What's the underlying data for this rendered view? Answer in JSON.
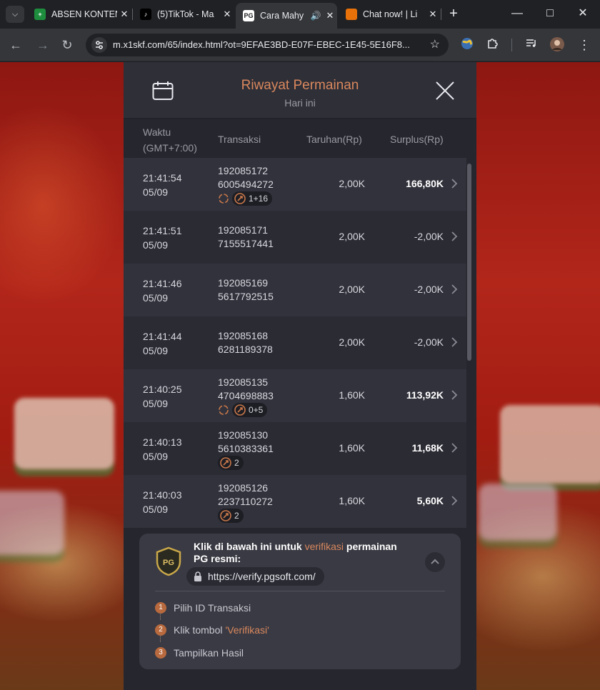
{
  "browser": {
    "tabs": [
      {
        "title": "ABSEN KONTEN",
        "favicon_color": "#1e8e3e",
        "favicon_text": "+",
        "active": false
      },
      {
        "title": "(5)TikTok - Ma",
        "favicon_color": "#000000",
        "favicon_text": "♪",
        "active": false
      },
      {
        "title": "Cara Mahy",
        "favicon_color": "#ffffff",
        "favicon_text": "PG",
        "active": true
      },
      {
        "title": "Chat now! | Li",
        "favicon_color": "#e8710a",
        "favicon_text": "",
        "active": false
      }
    ],
    "url": "m.x1skf.com/65/index.html?ot=9EFAE3BD-E07F-EBEC-1E45-5E16F8..."
  },
  "panel": {
    "title": "Riwayat Permainan",
    "subtitle": "Hari ini",
    "columns": {
      "time": "Waktu",
      "timezone": "(GMT+7:00)",
      "transaction": "Transaksi",
      "bet": "Taruhan(Rp)",
      "surplus": "Surplus(Rp)"
    },
    "rows": [
      {
        "time": "21:41:54",
        "date": "05/09",
        "tx_a": "192085172",
        "tx_b": "6005494272",
        "bet": "2,00K",
        "surplus": "166,80K",
        "positive": true,
        "badge": "1+16",
        "spin_icon": true
      },
      {
        "time": "21:41:51",
        "date": "05/09",
        "tx_a": "192085171",
        "tx_b": "7155517441",
        "bet": "2,00K",
        "surplus": "-2,00K",
        "positive": false,
        "badge": "",
        "spin_icon": false
      },
      {
        "time": "21:41:46",
        "date": "05/09",
        "tx_a": "192085169",
        "tx_b": "5617792515",
        "bet": "2,00K",
        "surplus": "-2,00K",
        "positive": false,
        "badge": "",
        "spin_icon": false
      },
      {
        "time": "21:41:44",
        "date": "05/09",
        "tx_a": "192085168",
        "tx_b": "6281189378",
        "bet": "2,00K",
        "surplus": "-2,00K",
        "positive": false,
        "badge": "",
        "spin_icon": false
      },
      {
        "time": "21:40:25",
        "date": "05/09",
        "tx_a": "192085135",
        "tx_b": "4704698883",
        "bet": "1,60K",
        "surplus": "113,92K",
        "positive": true,
        "badge": "0+5",
        "spin_icon": true
      },
      {
        "time": "21:40:13",
        "date": "05/09",
        "tx_a": "192085130",
        "tx_b": "5610383361",
        "bet": "1,60K",
        "surplus": "11,68K",
        "positive": true,
        "badge": "2",
        "spin_icon": false
      },
      {
        "time": "21:40:03",
        "date": "05/09",
        "tx_a": "192085126",
        "tx_b": "2237110272",
        "bet": "1,60K",
        "surplus": "5,60K",
        "positive": true,
        "badge": "2",
        "spin_icon": false
      }
    ]
  },
  "verify": {
    "text_before": "Klik di bawah ini untuk ",
    "text_highlight": "verifikasi",
    "text_after": " permainan PG resmi:",
    "url": "https://verify.pgsoft.com/",
    "logo_text": "PG",
    "steps": [
      {
        "num": "1",
        "text": "Pilih ID Transaksi",
        "highlight": ""
      },
      {
        "num": "2",
        "text": "Klik tombol",
        "highlight": "'Verifikasi'"
      },
      {
        "num": "3",
        "text": "Tampilkan Hasil",
        "highlight": ""
      }
    ]
  },
  "colors": {
    "accent": "#d9885d",
    "panel_bg": "#26262e"
  }
}
